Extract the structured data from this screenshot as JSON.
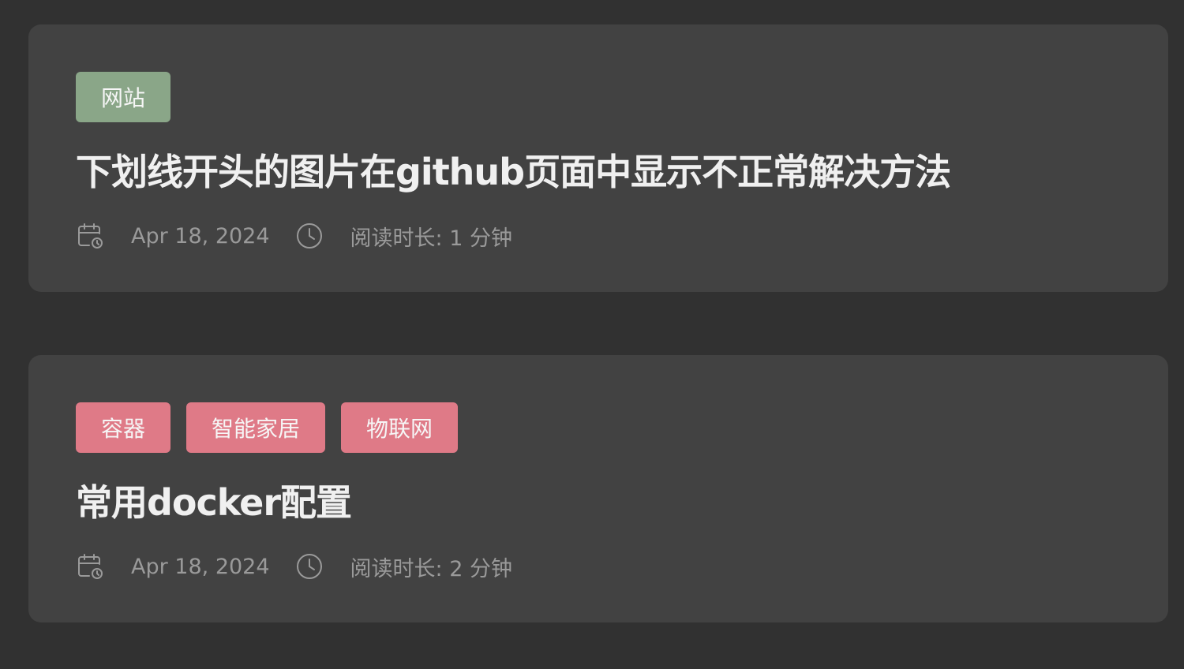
{
  "posts": [
    {
      "tags": [
        {
          "label": "网站",
          "color": "#8aa688"
        }
      ],
      "title": "下划线开头的图片在github页面中显示不正常解决方法",
      "date": "Apr 18, 2024",
      "date_icon": "calendar-clock-icon",
      "readtime_icon": "clock-icon",
      "reading_time": "阅读时长: 1 分钟"
    },
    {
      "tags": [
        {
          "label": "容器",
          "color": "#df7a87"
        },
        {
          "label": "智能家居",
          "color": "#df7a87"
        },
        {
          "label": "物联网",
          "color": "#df7a87"
        }
      ],
      "title": "常用docker配置",
      "date": "Apr 18, 2024",
      "date_icon": "calendar-clock-icon",
      "readtime_icon": "clock-icon",
      "reading_time": "阅读时长: 2 分钟"
    }
  ],
  "colors": {
    "page_background": "#313131",
    "card_background": "#424242",
    "title_text": "#f0f0f0",
    "meta_text": "#9a9a9a"
  }
}
